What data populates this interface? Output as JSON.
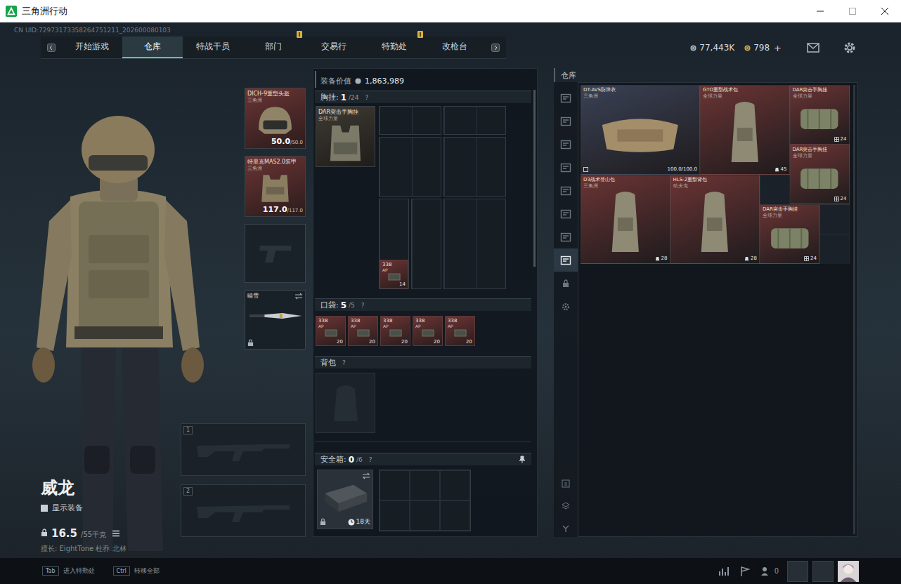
{
  "window": {
    "title": "三角洲行动"
  },
  "uid": "CN UID:72973173358264751211_202600080103",
  "nav": {
    "tabs": [
      {
        "label": "开始游戏",
        "selected": false,
        "alert": false
      },
      {
        "label": "仓库",
        "selected": true,
        "alert": false
      },
      {
        "label": "特战干员",
        "selected": false,
        "alert": false
      },
      {
        "label": "部门",
        "selected": false,
        "alert": true
      },
      {
        "label": "交易行",
        "selected": false,
        "alert": false
      },
      {
        "label": "特勤处",
        "selected": false,
        "alert": true
      },
      {
        "label": "改枪台",
        "selected": false,
        "alert": false
      }
    ]
  },
  "currencies": [
    {
      "amount": "77,443K",
      "color": "#aab2ba"
    },
    {
      "amount": "798",
      "color": "#c9a24a",
      "plus": "+"
    }
  ],
  "operator": {
    "name": "威龙",
    "show_gear_label": "显示装备",
    "show_gear": false,
    "weight": "16.5",
    "weight_limit": "/55千克",
    "perks": "擅长: EightTone 杜乔 北林"
  },
  "loadout": [
    {
      "kind": "helmet",
      "name": "DICH-9重型头盔",
      "brand": "三角洲",
      "durability": "50.0",
      "max": "/50.0",
      "color": "#6b3434"
    },
    {
      "kind": "armor",
      "name": "特里克MAS2.0装甲",
      "brand": "三角洲",
      "durability": "117.0",
      "max": "/117.0",
      "color": "#6b3434"
    },
    {
      "kind": "pistol",
      "empty": true
    },
    {
      "kind": "melee",
      "name": "晴雪",
      "locked": true
    }
  ],
  "weapons": [
    {
      "slot": "1",
      "empty": true
    },
    {
      "slot": "2",
      "empty": true
    }
  ],
  "gear": {
    "value_label": "装备价值",
    "value": "1,863,989",
    "chest": {
      "label": "胸挂:",
      "count": "1",
      "capacity": "/24",
      "help": "?",
      "item": {
        "name": "DAR突击手胸挂",
        "brand": "全球力量",
        "color": "#3e3a33"
      },
      "ammo": {
        "caliber": "338",
        "type": "AP",
        "count": "14",
        "color": "#6b3434"
      }
    },
    "pockets": {
      "label": "口袋:",
      "count": "5",
      "capacity": "/5",
      "help": "?",
      "items": [
        {
          "caliber": "338",
          "type": "AP",
          "count": "20",
          "color": "#6b3434"
        },
        {
          "caliber": "338",
          "type": "AP",
          "count": "20",
          "color": "#6b3434"
        },
        {
          "caliber": "338",
          "type": "AP",
          "count": "20",
          "color": "#6b3434"
        },
        {
          "caliber": "338",
          "type": "AP",
          "count": "20",
          "color": "#6b3434"
        },
        {
          "caliber": "338",
          "type": "AP",
          "count": "20",
          "color": "#6b3434"
        }
      ]
    },
    "backpack": {
      "label": "背包",
      "help": "?",
      "empty": true
    },
    "safe": {
      "label": "安全箱:",
      "count": "0",
      "capacity": "/6",
      "help": "?",
      "pinned": true,
      "locked": true,
      "time": "18天"
    }
  },
  "warehouse": {
    "title": "仓库",
    "tabs": [
      {
        "kind": "category",
        "selected": false
      },
      {
        "kind": "category",
        "selected": false
      },
      {
        "kind": "category",
        "selected": false
      },
      {
        "kind": "category",
        "selected": false
      },
      {
        "kind": "category",
        "selected": false
      },
      {
        "kind": "category",
        "selected": false
      },
      {
        "kind": "category",
        "selected": false
      },
      {
        "kind": "category",
        "selected": true
      },
      {
        "kind": "lock",
        "selected": false
      },
      {
        "kind": "settings",
        "selected": false
      }
    ],
    "items": [
      {
        "kind": "armor",
        "name": "DT-AVS防弹衣",
        "brand": "三角洲",
        "durability": "100.0/100.0",
        "color": "#3a4155"
      },
      {
        "kind": "backpack",
        "name": "GTO重型战术包",
        "brand": "全球力量",
        "capacity": "45",
        "color": "#6b3434"
      },
      {
        "kind": "rig",
        "name": "DAR突击手胸挂",
        "brand": "全球力量",
        "capacity": "24",
        "color": "#6b3434"
      },
      {
        "kind": "rig",
        "name": "DAR突击手胸挂",
        "brand": "全球力量",
        "capacity": "24",
        "color": "#6b3434"
      },
      {
        "kind": "backpack",
        "name": "D3战术登山包",
        "brand": "三角洲",
        "capacity": "28",
        "color": "#6b3434"
      },
      {
        "kind": "backpack",
        "name": "HLS-2重型背包",
        "brand": "哈夫克",
        "capacity": "28",
        "color": "#6b3434"
      },
      {
        "kind": "rig",
        "name": "DAR突击手胸挂",
        "brand": "全球力量",
        "capacity": "24",
        "color": "#6b3434"
      }
    ]
  },
  "bottom": {
    "hints": [
      {
        "key": "Tab",
        "label": "进入特勤处"
      },
      {
        "key": "Ctrl",
        "label": "转移全部"
      }
    ],
    "friends": "0"
  }
}
